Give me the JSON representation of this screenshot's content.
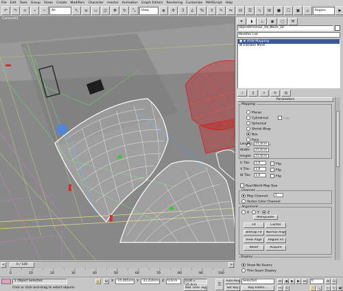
{
  "menu": [
    "File",
    "Edit",
    "Tools",
    "Group",
    "Views",
    "Create",
    "Modifiers",
    "Character",
    "reactor",
    "Animation",
    "Graph Editors",
    "Rendering",
    "Customize",
    "MAXScript",
    "Help"
  ],
  "toolbar": {
    "filter": "All",
    "view": "View",
    "region": "Region"
  },
  "viewport": {
    "label": "Camera01"
  },
  "panel": {
    "object_name": "objectArmchair_09_Mesh_10",
    "modifier_list": "Modifier List",
    "stack": [
      "UVW Mapping",
      "Editable Mesh"
    ],
    "rollout_title": "Parameters",
    "mapping": {
      "title": "Mapping:",
      "options": [
        "Planar",
        "Cylindrical",
        "Spherical",
        "Shrink Wrap",
        "Box",
        "Face",
        "XYZ to UVW"
      ],
      "selected": "Box",
      "cap_label": "Cap"
    },
    "dims": [
      {
        "label": "Length:",
        "value": "21,0cm"
      },
      {
        "label": "Width:",
        "value": "21,0cm"
      },
      {
        "label": "Height:",
        "value": "21,0cm"
      }
    ],
    "tiles": [
      {
        "label": "U Tile:",
        "value": "1,0",
        "flip": "Flip"
      },
      {
        "label": "V Tile:",
        "value": "1,0",
        "flip": "Flip"
      },
      {
        "label": "W Tile:",
        "value": "1,0",
        "flip": "Flip"
      }
    ],
    "real_world": "Real-World Map Size",
    "channel": {
      "title": "Channel:",
      "map_channel": "Map Channel:",
      "map_channel_value": "1",
      "vertex_color": "Vertex Color Channel"
    },
    "alignment": {
      "title": "Alignment:",
      "axes": [
        "X",
        "Y",
        "Z"
      ],
      "selected": "Z",
      "manipulate": "Manipulate",
      "buttons": [
        [
          "Fit",
          "Center"
        ],
        [
          "Bitmap Fit",
          "Normal Align"
        ],
        [
          "View Align",
          "Region Fit"
        ],
        [
          "Reset",
          "Acquire"
        ]
      ]
    },
    "display": {
      "title": "Display:",
      "options": [
        "Show No Seams",
        "Thin Seam Display"
      ]
    }
  },
  "timeline": {
    "frame": "0 / 100",
    "ticks": [
      "0",
      "10",
      "20",
      "30",
      "40",
      "50",
      "60",
      "70",
      "80",
      "90",
      "100"
    ]
  },
  "status": {
    "selected": "1 Object Selected",
    "prompt": "Click or click-and-drag to select objects",
    "x_label": "X:",
    "x_value": "-15,465cm",
    "y_label": "Y:",
    "y_value": "-31,430cm",
    "z_label": "Z:",
    "z_value": "0,0cm",
    "grid": "Grid = 25,4cm",
    "add_time_tag": "Add Time Tag",
    "auto_key": "Auto Key",
    "set_key": "Set Key",
    "selected_dropdown": "Selected",
    "key_filters": "Key Filters...",
    "frame_field": "0"
  }
}
